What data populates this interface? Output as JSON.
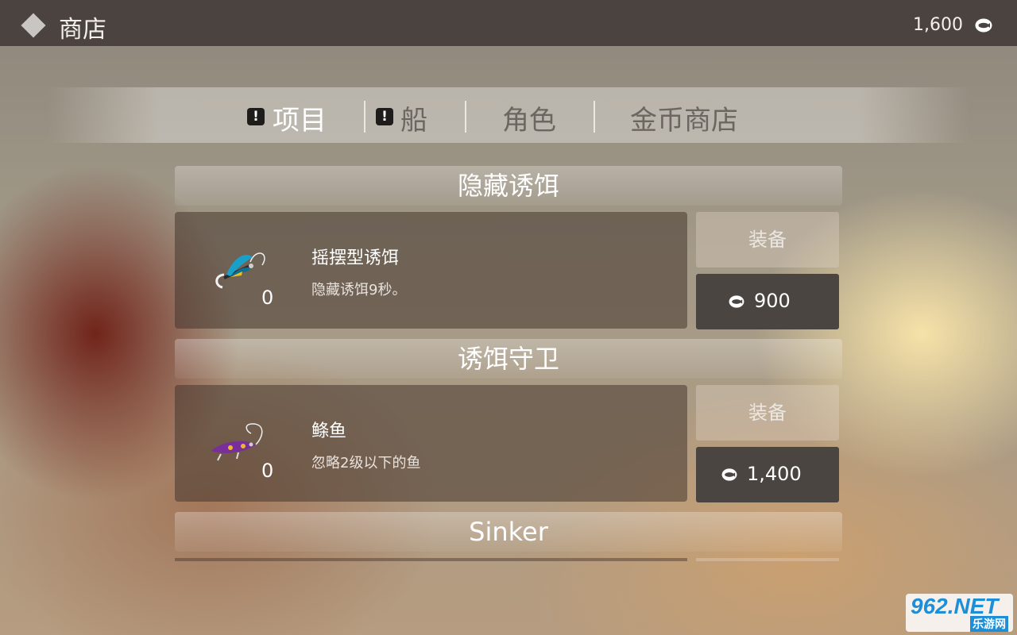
{
  "header": {
    "title": "商店",
    "coins": "1,600"
  },
  "tabs": [
    {
      "label": "项目",
      "badge": "!"
    },
    {
      "label": "船",
      "badge": "!"
    },
    {
      "label": "角色"
    },
    {
      "label": "金币商店"
    }
  ],
  "sections": [
    {
      "title": "隐藏诱饵",
      "item": {
        "name": "摇摆型诱饵",
        "desc": "隐藏诱饵9秒。",
        "count": "0"
      },
      "equip_label": "装备",
      "price": "900"
    },
    {
      "title": "诱饵守卫",
      "item": {
        "name": "鲦鱼",
        "desc": "忽略2级以下的鱼",
        "count": "0"
      },
      "equip_label": "装备",
      "price": "1,400"
    },
    {
      "title": "Sinker"
    }
  ],
  "watermark": {
    "top": "962.NET",
    "sub": "乐游网"
  },
  "colors": {
    "topbar": "#4a4340",
    "buy_button": "#4a4540",
    "equip_button": "#e6d7c8"
  }
}
